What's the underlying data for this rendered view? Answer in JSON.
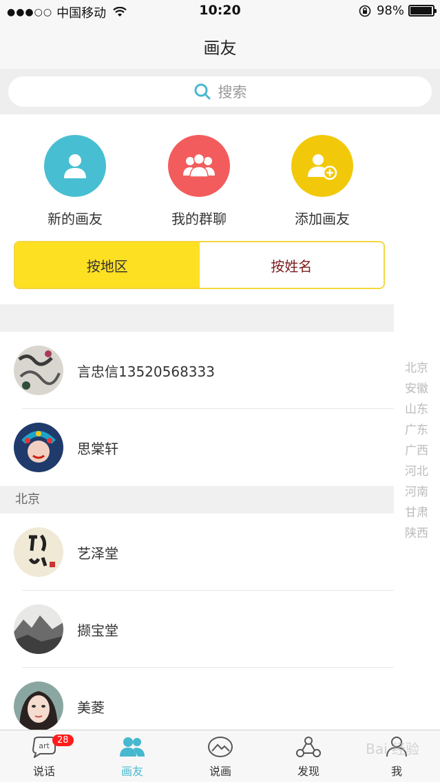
{
  "status_bar": {
    "signal": "●●●○○",
    "carrier": "中国移动",
    "time": "10:20",
    "battery_percent": "98%",
    "battery_level": 0.98
  },
  "nav": {
    "title": "画友"
  },
  "search": {
    "placeholder": "搜索"
  },
  "quick_actions": [
    {
      "label": "新的画友",
      "color": "#48bed2"
    },
    {
      "label": "我的群聊",
      "color": "#f35c5c"
    },
    {
      "label": "添加画友",
      "color": "#f2c90a"
    }
  ],
  "segments": {
    "by_region": "按地区",
    "by_name": "按姓名"
  },
  "list": {
    "ungrouped": [
      {
        "name": "言忠信13520568333"
      },
      {
        "name": "思棠轩"
      }
    ],
    "sections": [
      {
        "title": "北京",
        "items": [
          {
            "name": "艺泽堂"
          },
          {
            "name": "撷宝堂"
          },
          {
            "name": "美菱"
          }
        ]
      }
    ]
  },
  "index_bar": [
    "北京",
    "安徽",
    "山东",
    "广东",
    "广西",
    "河北",
    "河南",
    "甘肃",
    "陕西"
  ],
  "tabs": [
    {
      "label": "说话",
      "badge": "28"
    },
    {
      "label": "画友"
    },
    {
      "label": "说画"
    },
    {
      "label": "发现"
    },
    {
      "label": "我"
    }
  ],
  "watermark": "Bai 经验",
  "colors": {
    "accent": "#46b8cf",
    "segment_active": "#fee022",
    "badge": "#ff1b1b"
  }
}
